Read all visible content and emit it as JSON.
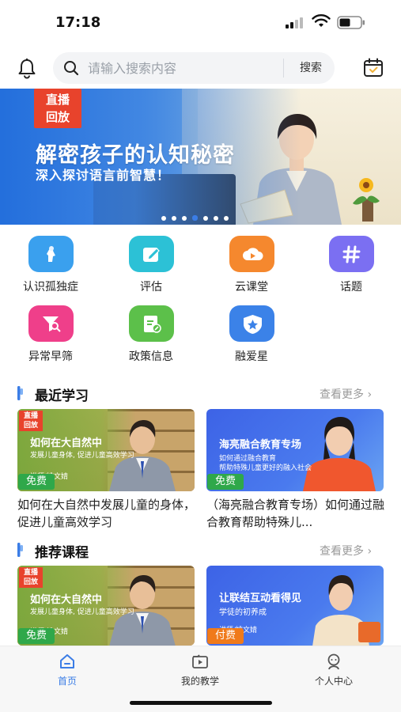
{
  "status_bar": {
    "time": "17:18"
  },
  "header": {
    "search_placeholder": "请输入搜索内容",
    "search_button": "搜索"
  },
  "banner": {
    "badge_line1": "直播",
    "badge_line2": "回放",
    "title": "解密孩子的认知秘密",
    "subtitle": "深入探讨语言前智慧！",
    "dot_count": 7,
    "active_dot": 4
  },
  "menu": {
    "items": [
      {
        "label": "认识孤独症",
        "icon": "person-icon",
        "color": "#3aa0ee"
      },
      {
        "label": "评估",
        "icon": "edit-icon",
        "color": "#2cc1d6"
      },
      {
        "label": "云课堂",
        "icon": "cloud-play-icon",
        "color": "#f5882e"
      },
      {
        "label": "话题",
        "icon": "hash-icon",
        "color": "#7b6ff2"
      },
      {
        "label": "异常早筛",
        "icon": "filter-search-icon",
        "color": "#ef3f8a"
      },
      {
        "label": "政策信息",
        "icon": "document-icon",
        "color": "#5cc04a"
      },
      {
        "label": "融爱星",
        "icon": "star-badge-icon",
        "color": "#3b82e8"
      }
    ]
  },
  "recent": {
    "title": "最近学习",
    "more": "查看更多",
    "cards": [
      {
        "thumb_badge_1": "直播",
        "thumb_badge_2": "回放",
        "thumb_title": "如何在大自然中",
        "thumb_line1": "发展儿童身体, 促进儿童高效学习",
        "thumb_line2": "讲师/姚文婧",
        "tag": "免费",
        "title": "如何在大自然中发展儿童的身体，促进儿童高效学习"
      },
      {
        "thumb_title": "海亮融合教育专场",
        "thumb_line1": "如何通过融合教育",
        "thumb_line2": "帮助特殊儿童更好的融入社会",
        "tag": "免费",
        "title": "（海亮融合教育专场）如何通过融合教育帮助特殊儿..."
      }
    ]
  },
  "recommended": {
    "title": "推荐课程",
    "more": "查看更多",
    "cards": [
      {
        "thumb_badge_1": "直播",
        "thumb_badge_2": "回放",
        "thumb_title": "如何在大自然中",
        "thumb_line1": "发展儿童身体, 促进儿童高效学习",
        "thumb_line2": "讲师/姚文婧",
        "tag": "免费"
      },
      {
        "thumb_title": "让联结互动看得见",
        "thumb_line1": "学徒的初养成",
        "thumb_line2": "讲师/姚文婧",
        "tag": "付费"
      }
    ]
  },
  "tabbar": {
    "tabs": [
      {
        "label": "首页",
        "icon": "home-icon",
        "active": true
      },
      {
        "label": "我的教学",
        "icon": "video-folder-icon",
        "active": false
      },
      {
        "label": "个人中心",
        "icon": "user-icon",
        "active": false
      }
    ]
  },
  "colors": {
    "accent": "#3b7de6",
    "free": "#2fa84a",
    "paid": "#f07a1a"
  }
}
